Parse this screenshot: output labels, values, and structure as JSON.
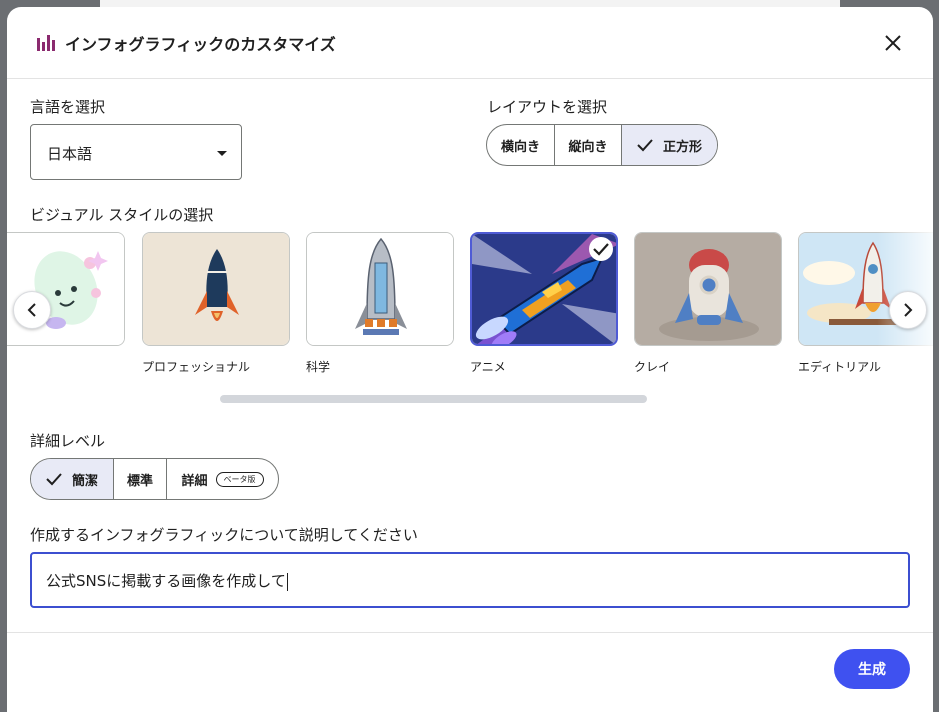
{
  "dialog": {
    "title": "インフォグラフィックのカスタマイズ",
    "header_icon": "bar-chart-icon",
    "close_icon": "close-icon"
  },
  "language": {
    "label": "言語を選択",
    "selected": "日本語"
  },
  "layout": {
    "label": "レイアウトを選択",
    "options": [
      {
        "label": "横向き",
        "selected": false
      },
      {
        "label": "縦向き",
        "selected": false
      },
      {
        "label": "正方形",
        "selected": true
      }
    ]
  },
  "visual_style": {
    "label": "ビジュアル スタイルの選択",
    "cards": [
      {
        "caption": "",
        "selected": false
      },
      {
        "caption": "プロフェッショナル",
        "selected": false
      },
      {
        "caption": "科学",
        "selected": false
      },
      {
        "caption": "アニメ",
        "selected": true
      },
      {
        "caption": "クレイ",
        "selected": false
      },
      {
        "caption": "エディトリアル",
        "selected": false
      }
    ]
  },
  "detail": {
    "label": "詳細レベル",
    "options": [
      {
        "label": "簡潔",
        "selected": true
      },
      {
        "label": "標準",
        "selected": false
      },
      {
        "label": "詳細",
        "selected": false,
        "badge": "ベータ版"
      }
    ]
  },
  "description": {
    "label": "作成するインフォグラフィックについて説明してください",
    "value": "公式SNSに掲載する画像を作成して"
  },
  "generate": {
    "label": "生成"
  },
  "colors": {
    "accent": "#3f51f0",
    "selected_bg": "#e8eaf6",
    "brand_icon": "#8b2a6f"
  }
}
